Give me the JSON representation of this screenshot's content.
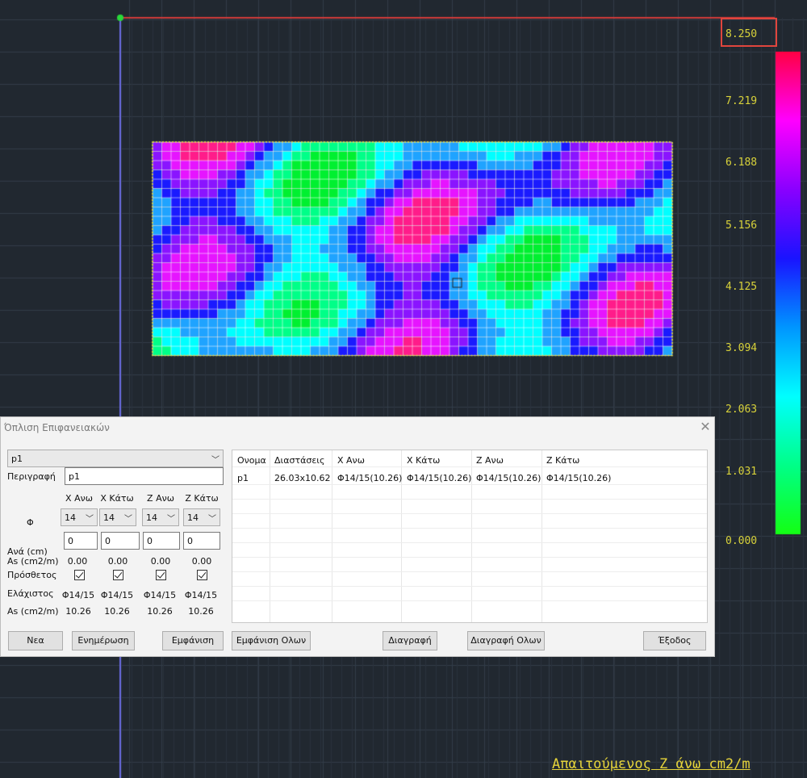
{
  "scale": {
    "values": [
      "8.250",
      "7.219",
      "6.188",
      "5.156",
      "4.125",
      "3.094",
      "2.063",
      "1.031",
      "0.000"
    ],
    "gradient_colors": [
      "#ff0044",
      "#ff00ff",
      "#8a00ff",
      "#1a14ff",
      "#0096ff",
      "#00ffff",
      "#00ff88",
      "#14ff14"
    ]
  },
  "caption": "Απαιτούμενος Z άνω cm2/m",
  "heatmap": {
    "colors": [
      "#00f030",
      "#00ff88",
      "#00ffff",
      "#1fa3ff",
      "#1a1aff",
      "#8a14ff",
      "#e614ff",
      "#ff1c8a"
    ],
    "border_color": "#e8e23a"
  },
  "dialog": {
    "title": "Όπλιση Επιφανειακών",
    "close": "✕",
    "selector_value": "p1",
    "description_label": "Περιγραφή",
    "description_value": "p1",
    "columns": [
      "X Ανω",
      "X Κάτω",
      "Z Ανω",
      "Z Κάτω"
    ],
    "phi_label": "Φ",
    "phi_values": [
      "14",
      "14",
      "14",
      "14"
    ],
    "spacing_label": "Ανά (cm)",
    "spacing_values": [
      "0",
      "0",
      "0",
      "0"
    ],
    "as_label": "As (cm2/m)",
    "as_values": [
      "0.00",
      "0.00",
      "0.00",
      "0.00"
    ],
    "additional_label": "Πρόσθετος",
    "minimum_label": "Ελάχιστος",
    "minimum_values": [
      "Φ14/15",
      "Φ14/15",
      "Φ14/15",
      "Φ14/15"
    ],
    "as_min_label": "As (cm2/m)",
    "as_min_values": [
      "10.26",
      "10.26",
      "10.26",
      "10.26"
    ],
    "buttons": {
      "new": "Νεα",
      "update": "Ενημέρωση",
      "show": "Εμφάνιση",
      "show_all": "Εμφάνιση Ολων",
      "delete": "Διαγραφή",
      "delete_all": "Διαγραφή Ολων",
      "exit": "Έξοδος"
    },
    "table": {
      "headers": [
        "Ονομα",
        "Διαστάσεις",
        "X Ανω",
        "X Κάτω",
        "Z Ανω",
        "Z Κάτω"
      ],
      "rows": [
        [
          "p1",
          "26.03x10.62",
          "Φ14/15(10.26)",
          "Φ14/15(10.26)",
          "Φ14/15(10.26)",
          "Φ14/15(10.26)"
        ]
      ]
    }
  }
}
